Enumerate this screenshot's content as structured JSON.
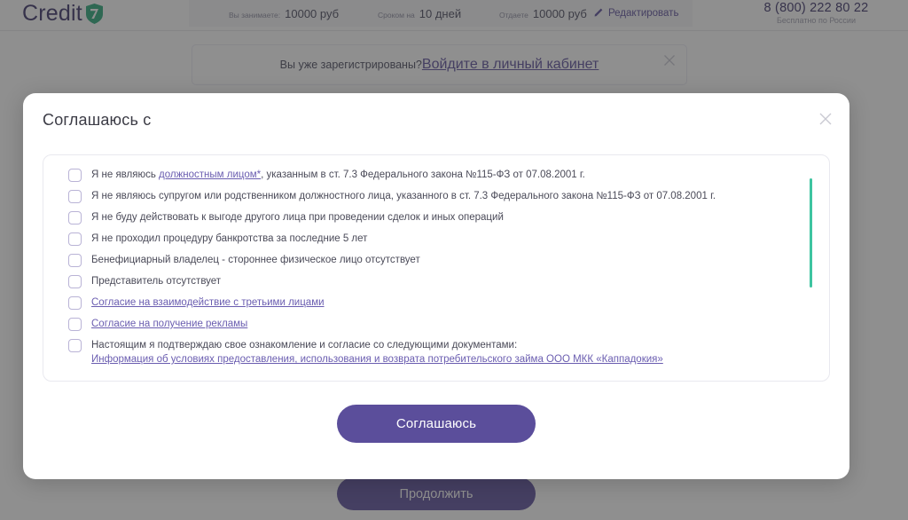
{
  "header": {
    "logo_text": "Credit",
    "logo_mark": "seven-shield-logo",
    "calculator": [
      {
        "label": "Вы занимаете:",
        "value": "10000 руб"
      },
      {
        "label": "Сроком на",
        "value": "10 дней"
      },
      {
        "label": "Отдаете",
        "value": "10000 руб"
      }
    ],
    "edit_label": "Редактировать",
    "edit_icon": "pencil-icon",
    "phone": "8 (800) 222 80 22",
    "phone_sub": "Бесплатно по России"
  },
  "notice": {
    "text": "Вы уже зарегистрированы?",
    "link": "Войдите в личный кабинет",
    "close_icon": "close-icon"
  },
  "page": {
    "continue_label": "Продолжить"
  },
  "modal": {
    "title": "Соглашаюсь с",
    "close_icon": "close-icon",
    "agree_label": "Соглашаюсь",
    "scrollbar_color": "#3ec4a0",
    "accent_color": "#5b4e9b",
    "items": [
      {
        "type": "rich",
        "pre": "Я не являюсь ",
        "link": "должностным лицом*",
        "post": ", указанным в ст. 7.3 Федерального закона №115-ФЗ от 07.08.2001 г."
      },
      {
        "type": "text",
        "text": "Я не являюсь супругом или родственником должностного лица, указанного в ст. 7.3 Федерального закона №115-ФЗ от 07.08.2001 г."
      },
      {
        "type": "text",
        "text": "Я не буду действовать к выгоде другого лица при проведении сделок и иных операций"
      },
      {
        "type": "text",
        "text": "Я не проходил процедуру банкротства за последние 5 лет"
      },
      {
        "type": "text",
        "text": "Бенефициарный владелец - стороннее физическое лицо отсутствует"
      },
      {
        "type": "text",
        "text": "Представитель отсутствует"
      },
      {
        "type": "link",
        "text": "Согласие на взаимодействие с третьими лицами"
      },
      {
        "type": "link",
        "text": "Согласие на получение рекламы"
      },
      {
        "type": "documents",
        "text": "Настоящим я подтверждаю свое ознакомление и согласие со следующими документами:",
        "doc": "Информация об условиях предоставления, использования и возврата потребительского займа ООО МКК «Каппадокия»"
      }
    ]
  }
}
